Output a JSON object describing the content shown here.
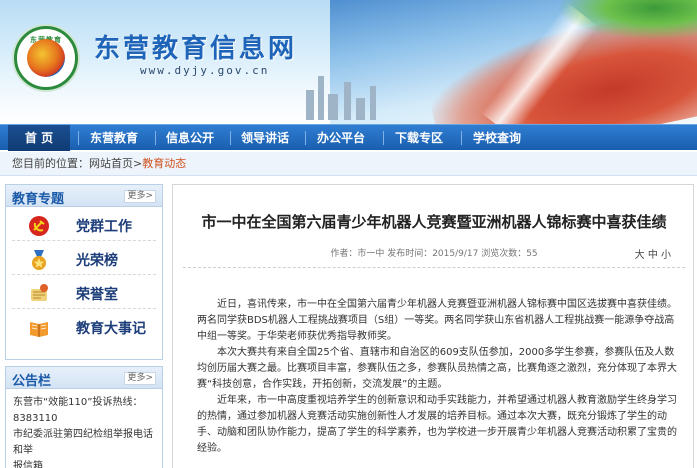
{
  "header": {
    "logo_text": "东营教育",
    "site_title": "东营教育信息网",
    "site_url": "www.dyjy.gov.cn"
  },
  "nav": {
    "items": [
      {
        "label": "首  页",
        "active": true
      },
      {
        "label": "东营教育",
        "active": false
      },
      {
        "label": "信息公开",
        "active": false
      },
      {
        "label": "领导讲话",
        "active": false
      },
      {
        "label": "办公平台",
        "active": false
      },
      {
        "label": "下载专区",
        "active": false
      },
      {
        "label": "学校查询",
        "active": false
      }
    ]
  },
  "breadcrumb": {
    "prefix": "您目前的位置：网站首页>",
    "current": "教育动态"
  },
  "sidebar": {
    "topics_title": "教育专题",
    "more": "更多>",
    "topics": [
      "党群工作",
      "光荣榜",
      "荣誉室",
      "教育大事记"
    ],
    "notice_title": "公告栏",
    "notice_lines": [
      "东营市“效能110”投诉热线：",
      "8383110",
      "市纪委派驻第四纪检组举报电话和举",
      "报信箱"
    ]
  },
  "article": {
    "title": "市一中在全国第六届青少年机器人竞赛暨亚洲机器人锦标赛中喜获佳绩",
    "meta": "作者：市一中    发布时间：2015/9/17    浏览次数：55",
    "font_sizes": "大 中 小",
    "paragraphs": [
      "近日，喜讯传来，市一中在全国第六届青少年机器人竞赛暨亚洲机器人锦标赛中国区选拔赛中喜获佳绩。两名同学获BDS机器人工程挑战赛项目（S组）一等奖。两名同学获山东省机器人工程挑战赛一能源争夺战高中组一等奖。于华荣老师获优秀指导教师奖。",
      "本次大赛共有来自全国25个省、直辖市和自治区的609支队伍参加，2000多学生参赛，参赛队伍及人数均创历届大赛之最。比赛项目丰富，参赛队伍之多，参赛队员热情之高，比赛角逐之激烈，充分体现了本界大赛“科技创意，合作实践，开拓创新，交流发展”的主题。",
      "近年来，市一中高度重视培养学生的创新意识和动手实践能力，并希望通过机器人教育激励学生终身学习的热情，通过参加机器人竞赛活动实施创新性人才发展的培养目标。通过本次大赛，既充分锻炼了学生的动手、动脑和团队协作能力，提高了学生的科学素养，也为学校进一步开展青少年机器人竞赛活动积累了宝贵的经验。"
    ]
  },
  "colors": {
    "nav_blue": "#1a5eae",
    "title_blue": "#1e64b8",
    "crumb_current": "#d0521f"
  }
}
